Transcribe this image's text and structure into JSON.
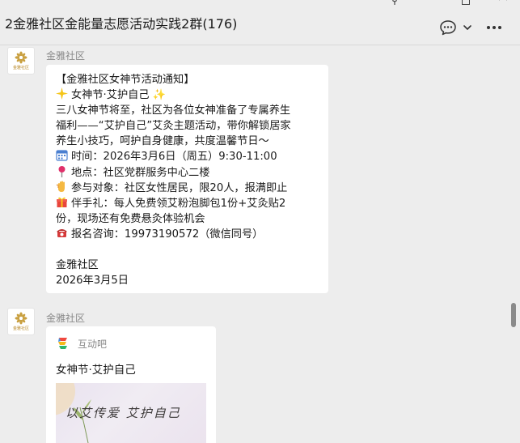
{
  "window": {
    "title": "2金雅社区金能量志愿活动实践2群(176)"
  },
  "toolbar": {
    "icons": [
      "pin-icon",
      "maximize-icon",
      "close-icon",
      "chat-icon",
      "chevron-down-icon",
      "more-icon"
    ]
  },
  "messages": [
    {
      "sender": "金雅社区",
      "avatar_text": "金雅社区",
      "lines": [
        {
          "icon": "",
          "text": "【金雅社区女神节活动通知】"
        },
        {
          "icon": "sparkle-icon",
          "text": "女神节·艾护自己 ✨"
        },
        {
          "icon": "",
          "text": "  三八女神节将至，社区为各位女神准备了专属养生"
        },
        {
          "icon": "",
          "text": "福利——“艾护自己”艾灸主题活动，带你解锁居家"
        },
        {
          "icon": "",
          "text": "养生小技巧，呵护自身健康，共度温馨节日～"
        },
        {
          "icon": "calendar-icon",
          "text": "时间：2026年3月6日（周五）9:30-11:00"
        },
        {
          "icon": "pin-location-icon",
          "text": "地点：社区党群服务中心二楼"
        },
        {
          "icon": "raised-hand-icon",
          "text": "参与对象：社区女性居民，限20人，报满即止"
        },
        {
          "icon": "gift-icon",
          "text": "伴手礼：每人免费领艾粉泡脚包1份+艾灸贴2"
        },
        {
          "icon": "",
          "text": "份，现场还有免费悬灸体验机会"
        },
        {
          "icon": "telephone-icon",
          "text": "报名咨询：19973190572（微信同号）"
        },
        {
          "icon": "",
          "text": ""
        },
        {
          "icon": "",
          "text": "金雅社区"
        },
        {
          "icon": "",
          "text": "2026年3月5日"
        }
      ]
    },
    {
      "sender": "金雅社区",
      "avatar_text": "金雅社区",
      "card": {
        "source_label": "互动吧",
        "title": "女神节·艾护自己",
        "image_caption": "以艾传爱  艾护自己"
      }
    }
  ],
  "colors": {
    "background": "#ededed",
    "bubble": "#ffffff",
    "sender_name": "#8a8a8a",
    "avatar_gold": "#b98a2a"
  }
}
